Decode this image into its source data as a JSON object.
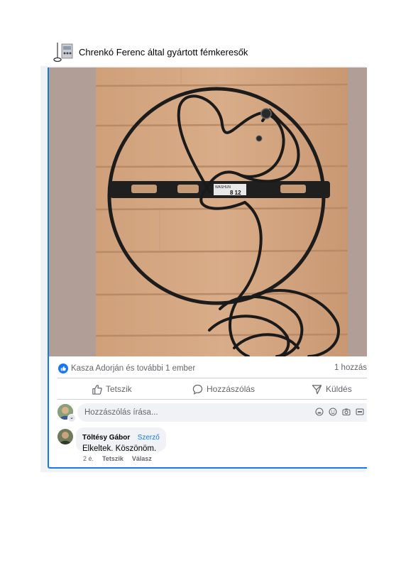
{
  "group": {
    "name": "Chrenkó Ferenc által gyártott fémkeresők"
  },
  "post": {
    "photo_label_1": "WASHUN",
    "photo_label_2": "8 12",
    "reactions": {
      "text": "Kasza Adorján és további 1 ember",
      "comment_count": "1 hozzás"
    },
    "actions": {
      "like": "Tetszik",
      "comment": "Hozzászólás",
      "send": "Küldés"
    },
    "composer": {
      "placeholder": "Hozzászólás írása..."
    },
    "comment": {
      "author": "Töltésy Gábor",
      "badge": "Szerző",
      "text": "Elkeltek. Köszönöm.",
      "time": "2 é.",
      "like": "Tetszik",
      "reply": "Válasz"
    }
  },
  "colors": {
    "accent": "#1877f2",
    "secondary_text": "#65676b",
    "bubble": "#f0f2f5"
  }
}
